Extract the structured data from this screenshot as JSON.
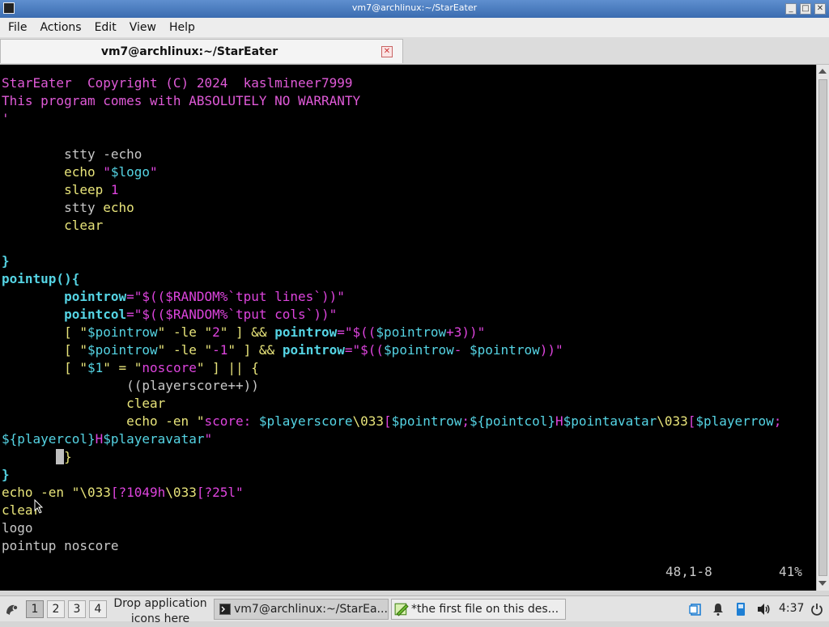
{
  "window": {
    "title": "vm7@archlinux:~/StarEater",
    "buttons": {
      "minimize": "_",
      "maximize": "□",
      "close": "✕"
    }
  },
  "menubar": {
    "items": [
      "File",
      "Actions",
      "Edit",
      "View",
      "Help"
    ]
  },
  "tab": {
    "title": "vm7@archlinux:~/StarEater",
    "close": "✕"
  },
  "terminal": {
    "lines": [
      {
        "row": 1,
        "segments": [
          {
            "t": "StarEater  Copyright (C) 2024  kaslmineer7999",
            "c": "pur"
          }
        ]
      },
      {
        "row": 2,
        "segments": [
          {
            "t": "This program comes with ABSOLUTELY NO WARRANTY",
            "c": "pur"
          }
        ]
      },
      {
        "row": 3,
        "segments": [
          {
            "t": "'",
            "c": "pur"
          }
        ]
      },
      {
        "row": 5,
        "segments": [
          {
            "t": "        stty -echo",
            "c": "def"
          }
        ]
      },
      {
        "row": 6,
        "segments": [
          {
            "t": "        echo ",
            "c": "yel"
          },
          {
            "t": "\"",
            "c": "mag"
          },
          {
            "t": "$logo",
            "c": "cyn"
          },
          {
            "t": "\"",
            "c": "mag"
          }
        ]
      },
      {
        "row": 7,
        "segments": [
          {
            "t": "        sleep ",
            "c": "yel"
          },
          {
            "t": "1",
            "c": "mag"
          }
        ]
      },
      {
        "row": 8,
        "segments": [
          {
            "t": "        stty ",
            "c": "def"
          },
          {
            "t": "echo",
            "c": "yel"
          }
        ]
      },
      {
        "row": 9,
        "segments": [
          {
            "t": "        clear",
            "c": "yel"
          }
        ]
      },
      {
        "row": 11,
        "segments": [
          {
            "t": "}",
            "c": "cynb"
          }
        ]
      },
      {
        "row": 12,
        "segments": [
          {
            "t": "pointup(){",
            "c": "cynb"
          }
        ]
      },
      {
        "row": 13,
        "segments": [
          {
            "t": "        ",
            "c": "def"
          },
          {
            "t": "pointrow",
            "c": "cynb"
          },
          {
            "t": "=\"$(($RANDOM%`tput lines`))\"",
            "c": "mag"
          }
        ]
      },
      {
        "row": 14,
        "segments": [
          {
            "t": "        ",
            "c": "def"
          },
          {
            "t": "pointcol",
            "c": "cynb"
          },
          {
            "t": "=\"$(($RANDOM%`tput cols`))\"",
            "c": "mag"
          }
        ]
      },
      {
        "row": 15,
        "segments": [
          {
            "t": "        [ \"",
            "c": "yel"
          },
          {
            "t": "$pointrow",
            "c": "cyn"
          },
          {
            "t": "\" -le \"",
            "c": "yel"
          },
          {
            "t": "2",
            "c": "mag"
          },
          {
            "t": "\" ] && ",
            "c": "yel"
          },
          {
            "t": "pointrow",
            "c": "cynb"
          },
          {
            "t": "=\"$((",
            "c": "mag"
          },
          {
            "t": "$pointrow",
            "c": "cyn"
          },
          {
            "t": "+3))\"",
            "c": "mag"
          }
        ]
      },
      {
        "row": 16,
        "segments": [
          {
            "t": "        [ \"",
            "c": "yel"
          },
          {
            "t": "$pointrow",
            "c": "cyn"
          },
          {
            "t": "\" -le \"",
            "c": "yel"
          },
          {
            "t": "-1",
            "c": "mag"
          },
          {
            "t": "\" ] && ",
            "c": "yel"
          },
          {
            "t": "pointrow",
            "c": "cynb"
          },
          {
            "t": "=\"$((",
            "c": "mag"
          },
          {
            "t": "$pointrow",
            "c": "cyn"
          },
          {
            "t": "- ",
            "c": "mag"
          },
          {
            "t": "$pointrow",
            "c": "cyn"
          },
          {
            "t": "))\"",
            "c": "mag"
          }
        ]
      },
      {
        "row": 17,
        "segments": [
          {
            "t": "        [ \"",
            "c": "yel"
          },
          {
            "t": "$1",
            "c": "cyn"
          },
          {
            "t": "\" = \"",
            "c": "yel"
          },
          {
            "t": "noscore",
            "c": "mag"
          },
          {
            "t": "\" ] || {",
            "c": "yel"
          }
        ]
      },
      {
        "row": 18,
        "segments": [
          {
            "t": "                ((playerscore++))",
            "c": "def"
          }
        ]
      },
      {
        "row": 19,
        "segments": [
          {
            "t": "                clear",
            "c": "yel"
          }
        ]
      },
      {
        "row": 20,
        "segments": [
          {
            "t": "                echo -en \"",
            "c": "yel"
          },
          {
            "t": "score: ",
            "c": "mag"
          },
          {
            "t": "$playerscore",
            "c": "cyn"
          },
          {
            "t": "\\033",
            "c": "yel"
          },
          {
            "t": "[",
            "c": "mag"
          },
          {
            "t": "$pointrow",
            "c": "cyn"
          },
          {
            "t": ";",
            "c": "mag"
          },
          {
            "t": "${pointcol}",
            "c": "cyn"
          },
          {
            "t": "H",
            "c": "mag"
          },
          {
            "t": "$pointavatar",
            "c": "cyn"
          },
          {
            "t": "\\033",
            "c": "yel"
          },
          {
            "t": "[",
            "c": "mag"
          },
          {
            "t": "$playerrow",
            "c": "cyn"
          },
          {
            "t": ";",
            "c": "mag"
          }
        ]
      },
      {
        "row": 21,
        "segments": [
          {
            "t": "${playercol}",
            "c": "cyn"
          },
          {
            "t": "H",
            "c": "mag"
          },
          {
            "t": "$playeravatar",
            "c": "cyn"
          },
          {
            "t": "\"",
            "c": "mag"
          }
        ]
      },
      {
        "row": 22,
        "segments": [
          {
            "t": "       ",
            "c": "def"
          },
          {
            "t": " ",
            "c": "cursor"
          },
          {
            "t": "}",
            "c": "yel"
          }
        ]
      },
      {
        "row": 23,
        "segments": [
          {
            "t": "}",
            "c": "cynb"
          }
        ]
      },
      {
        "row": 24,
        "segments": [
          {
            "t": "echo -en \"",
            "c": "yel"
          },
          {
            "t": "\\033",
            "c": "yel"
          },
          {
            "t": "[?1049h",
            "c": "mag"
          },
          {
            "t": "\\033",
            "c": "yel"
          },
          {
            "t": "[?25l",
            "c": "mag"
          },
          {
            "t": "\"",
            "c": "mag"
          }
        ]
      },
      {
        "row": 25,
        "segments": [
          {
            "t": "clear",
            "c": "yel"
          }
        ]
      },
      {
        "row": 26,
        "segments": [
          {
            "t": "logo",
            "c": "def"
          }
        ]
      },
      {
        "row": 27,
        "segments": [
          {
            "t": "pointup noscore",
            "c": "def"
          }
        ]
      }
    ],
    "status_position": "48,1-8",
    "status_percent": "41%"
  },
  "taskbar": {
    "workspaces": [
      "1",
      "2",
      "3",
      "4"
    ],
    "active_workspace": 0,
    "drop_zone": "Drop application icons here",
    "tasks": [
      {
        "label": "vm7@archlinux:~/StarEa...",
        "icon": "terminal-icon"
      },
      {
        "label": "*the first file on this des...",
        "icon": "text-editor-icon"
      }
    ],
    "clock": "4:37"
  }
}
